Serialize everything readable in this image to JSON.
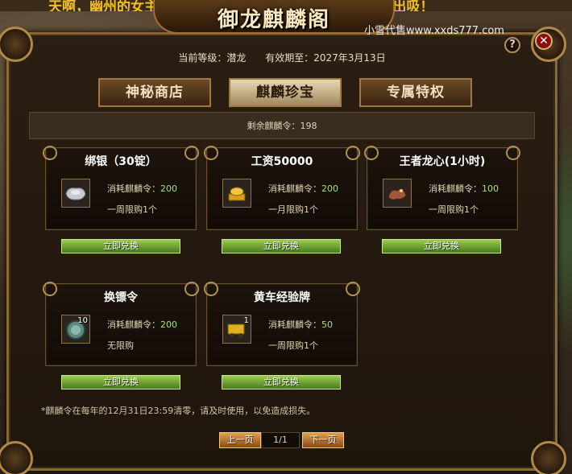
{
  "banner_text": "天啊，幽州的女主人竟然...露脸了！美女尽在酒绿多俊送出吸！",
  "window_title": "御龙麒麟阁",
  "watermark": "小雪代售www.xxds777.com",
  "help_label": "?",
  "close_label": "✕",
  "info": {
    "level_label": "当前等级：潜龙",
    "expiry_label": "有效期至：2027年3月13日"
  },
  "tabs": [
    {
      "label": "神秘商店"
    },
    {
      "label": "麒麟珍宝"
    },
    {
      "label": "专属特权"
    }
  ],
  "remaining": "剩余麒麟令：198",
  "items": [
    {
      "name": "绑银（30锭）",
      "cost_prefix": "消耗麒麟令：",
      "cost": "200",
      "limit": "一周限购1个",
      "quantity": "",
      "icon": "silver-ingot-icon"
    },
    {
      "name": "工资50000",
      "cost_prefix": "消耗麒麟令：",
      "cost": "200",
      "limit": "一月限购1个",
      "quantity": "",
      "icon": "gold-salary-icon"
    },
    {
      "name": "王者龙心(1小时)",
      "cost_prefix": "消耗麒麟令：",
      "cost": "100",
      "limit": "一周限购1个",
      "quantity": "",
      "icon": "dragon-heart-icon"
    },
    {
      "name": "换镖令",
      "cost_prefix": "消耗麒麟令：",
      "cost": "200",
      "limit": "无限购",
      "quantity": "10",
      "icon": "escort-token-icon"
    },
    {
      "name": "黄车经验牌",
      "cost_prefix": "消耗麒麟令：",
      "cost": "50",
      "limit": "一周限购1个",
      "quantity": "1",
      "icon": "yellow-cart-exp-icon"
    }
  ],
  "redeem_label": "立即兑换",
  "note": "*麒麟令在每年的12月31日23:59清零，请及时使用，以免造成损失。",
  "pagination": {
    "prev_label": "上一页",
    "page": "1/1",
    "next_label": "下一页"
  },
  "colors": {
    "accent_gold": "#b08848",
    "cost_green": "#a8e070",
    "redeem_green": "#6a9a30",
    "pager_orange": "#c87a30"
  }
}
